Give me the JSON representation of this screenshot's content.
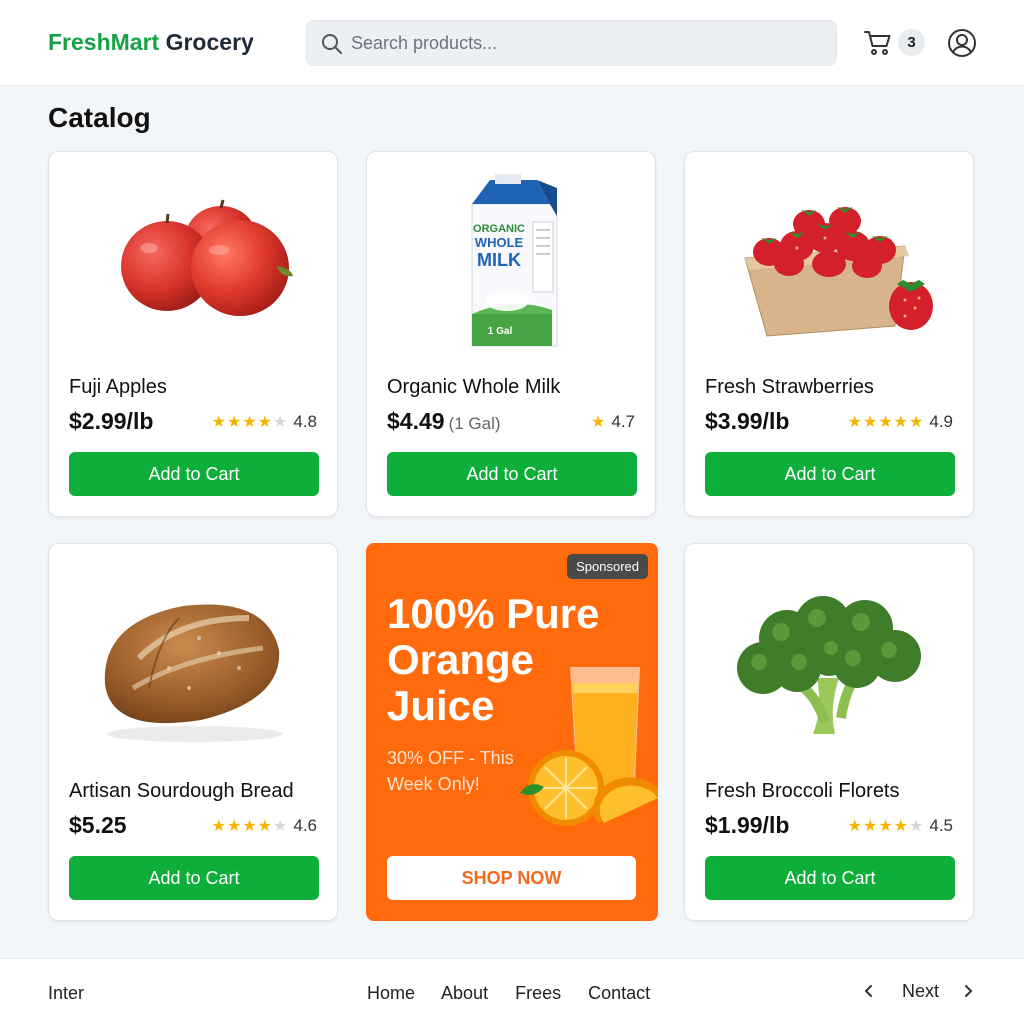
{
  "header": {
    "brand_green": "FreshMart",
    "brand_dark": "Grocery",
    "search_placeholder": "Search products...",
    "cart_count": "3",
    "brand_color": "#17a246"
  },
  "page_title": "Catalog",
  "products": [
    {
      "name": "Fuji Apples",
      "price": "$2.99/lb",
      "unit": "",
      "rating": "4.8",
      "stars": 4.8,
      "button": "Add to Cart",
      "image": "apples"
    },
    {
      "name": "Organic Whole Milk",
      "price": "$4.49",
      "unit": "(1 Gal)",
      "rating": "4.7",
      "stars": 1,
      "button": "Add to Cart",
      "image": "milk-carton",
      "carton_text": [
        "ORGANIC",
        "WHOLE",
        "MILK",
        "1 Gal"
      ]
    },
    {
      "name": "Fresh Strawberries",
      "price": "$3.99/lb",
      "unit": "",
      "rating": "4.9",
      "stars": 5,
      "button": "Add to Cart",
      "image": "strawberries"
    },
    {
      "name": "Artisan Sourdough Bread",
      "price": "$5.25",
      "unit": "",
      "rating": "4.6",
      "stars": 4.6,
      "button": "Add to Cart",
      "image": "bread"
    },
    {
      "name": "Fresh Broccoli Florets",
      "price": "$1.99/lb",
      "unit": "",
      "rating": "4.5",
      "stars": 4.5,
      "button": "Add to Cart",
      "image": "broccoli"
    }
  ],
  "ad": {
    "badge": "Sponsored",
    "headline": "100% Pure Orange Juice",
    "subtext": "30% OFF - This Week Only!",
    "cta": "SHOP NOW",
    "background": "#ff6a0d"
  },
  "footer": {
    "left_text": "Inter",
    "links": [
      "Home",
      "About",
      "Frees",
      "Contact"
    ],
    "next_label": "Next"
  },
  "colors": {
    "accent_green": "#0eae3a",
    "star": "#f5b400"
  }
}
